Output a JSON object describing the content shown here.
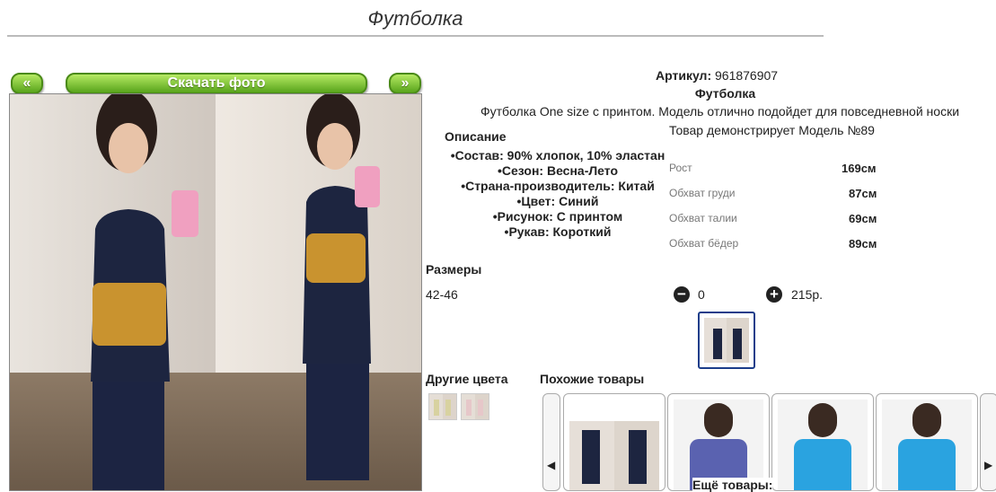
{
  "page": {
    "title": "Футболка"
  },
  "gallery": {
    "prev_label": "«",
    "download_label": "Скачать фото",
    "next_label": "»"
  },
  "product": {
    "article_label": "Артикул:",
    "article_value": "961876907",
    "name": "Футболка",
    "description": "Футболка One size с принтом. Модель отлично подойдет для повседневной носки",
    "model_note": "Товар демонстрирует Модель №89"
  },
  "description": {
    "heading": "Описание",
    "items": [
      "Состав: 90% хлопок, 10% эластан",
      "Сезон: Весна-Лето",
      "Страна-производитель: Китай",
      "Цвет: Синий",
      "Рисунок: С принтом",
      "Рукав: Короткий"
    ]
  },
  "measurements": [
    {
      "label": "Рост",
      "value": "169см"
    },
    {
      "label": "Обхват груди",
      "value": "87см"
    },
    {
      "label": "Обхват талии",
      "value": "69см"
    },
    {
      "label": "Обхват бёдер",
      "value": "89см"
    }
  ],
  "sizes": {
    "heading": "Размеры",
    "size": "42-46",
    "minus_icon": "minus-circle-icon",
    "plus_icon": "plus-circle-icon",
    "quantity": "0",
    "price": "215р."
  },
  "other_colors": {
    "heading": "Другие цвета"
  },
  "similar": {
    "heading": "Похожие товары",
    "more_label": "Ещё товары:"
  },
  "colors": {
    "button_green": "#58a41b",
    "button_border": "#4a8a17",
    "selected_border": "#1b3d8a",
    "shirt_navy": "#1d2540",
    "shirt_blue": "#2aa3e0"
  }
}
